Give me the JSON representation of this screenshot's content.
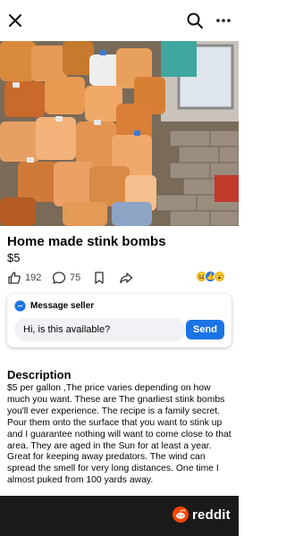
{
  "header": {
    "close_icon": "close-icon",
    "search_icon": "search-icon",
    "more_icon": "more-horizontal-icon"
  },
  "listing": {
    "title": "Home made stink bombs",
    "price": "$5",
    "image_description": "photo of many plastic jugs filled with orange liquid"
  },
  "actions": {
    "likes": "192",
    "comments": "75",
    "save_icon": "bookmark-icon",
    "share_icon": "share-icon",
    "reactions": [
      "haha",
      "like",
      "wow"
    ]
  },
  "message": {
    "heading": "Message seller",
    "input_value": "Hi, is this available?",
    "send_label": "Send"
  },
  "description": {
    "heading": "Description",
    "text": "$5 per gallon ,The price varies depending on how much you want. These are The gnarliest stink bombs you'll ever experience. The recipe is a family secret. Pour them onto the surface that you want to stink up and I guarantee nothing will want to come close to that area. They are aged in the Sun for at least a year. Great for keeping away predators. The wind can spread the smell for very long distances. One time I almost puked from 100 yards away."
  },
  "footer": {
    "brand": "reddit"
  },
  "colors": {
    "accent": "#1b74e4",
    "footer_bg": "#1a1a1b",
    "reddit_orange": "#ff4500"
  }
}
